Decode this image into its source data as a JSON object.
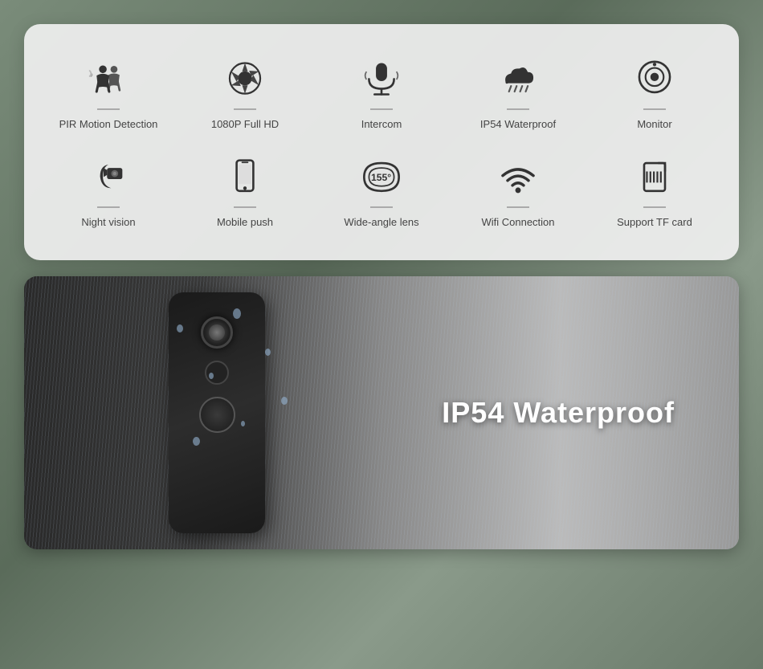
{
  "features": {
    "row1": [
      {
        "id": "pir-motion",
        "label": "PIR Motion Detection",
        "icon_type": "pir"
      },
      {
        "id": "fullhd",
        "label": "1080P Full HD",
        "icon_type": "fullhd"
      },
      {
        "id": "intercom",
        "label": "Intercom",
        "icon_type": "intercom"
      },
      {
        "id": "waterproof",
        "label": "IP54 Waterproof",
        "icon_type": "waterproof"
      },
      {
        "id": "monitor",
        "label": "Monitor",
        "icon_type": "monitor"
      }
    ],
    "row2": [
      {
        "id": "nightvision",
        "label": "Night vision",
        "icon_type": "nightvision"
      },
      {
        "id": "mobilepush",
        "label": "Mobile push",
        "icon_type": "mobilepush"
      },
      {
        "id": "wideangle",
        "label": "Wide-angle lens",
        "icon_type": "wideangle"
      },
      {
        "id": "wifi",
        "label": "Wifi Connection",
        "icon_type": "wifi"
      },
      {
        "id": "tfcard",
        "label": "Support TF card",
        "icon_type": "tfcard"
      }
    ]
  },
  "bottom_section": {
    "waterproof_text": "IP54 Waterproof"
  }
}
